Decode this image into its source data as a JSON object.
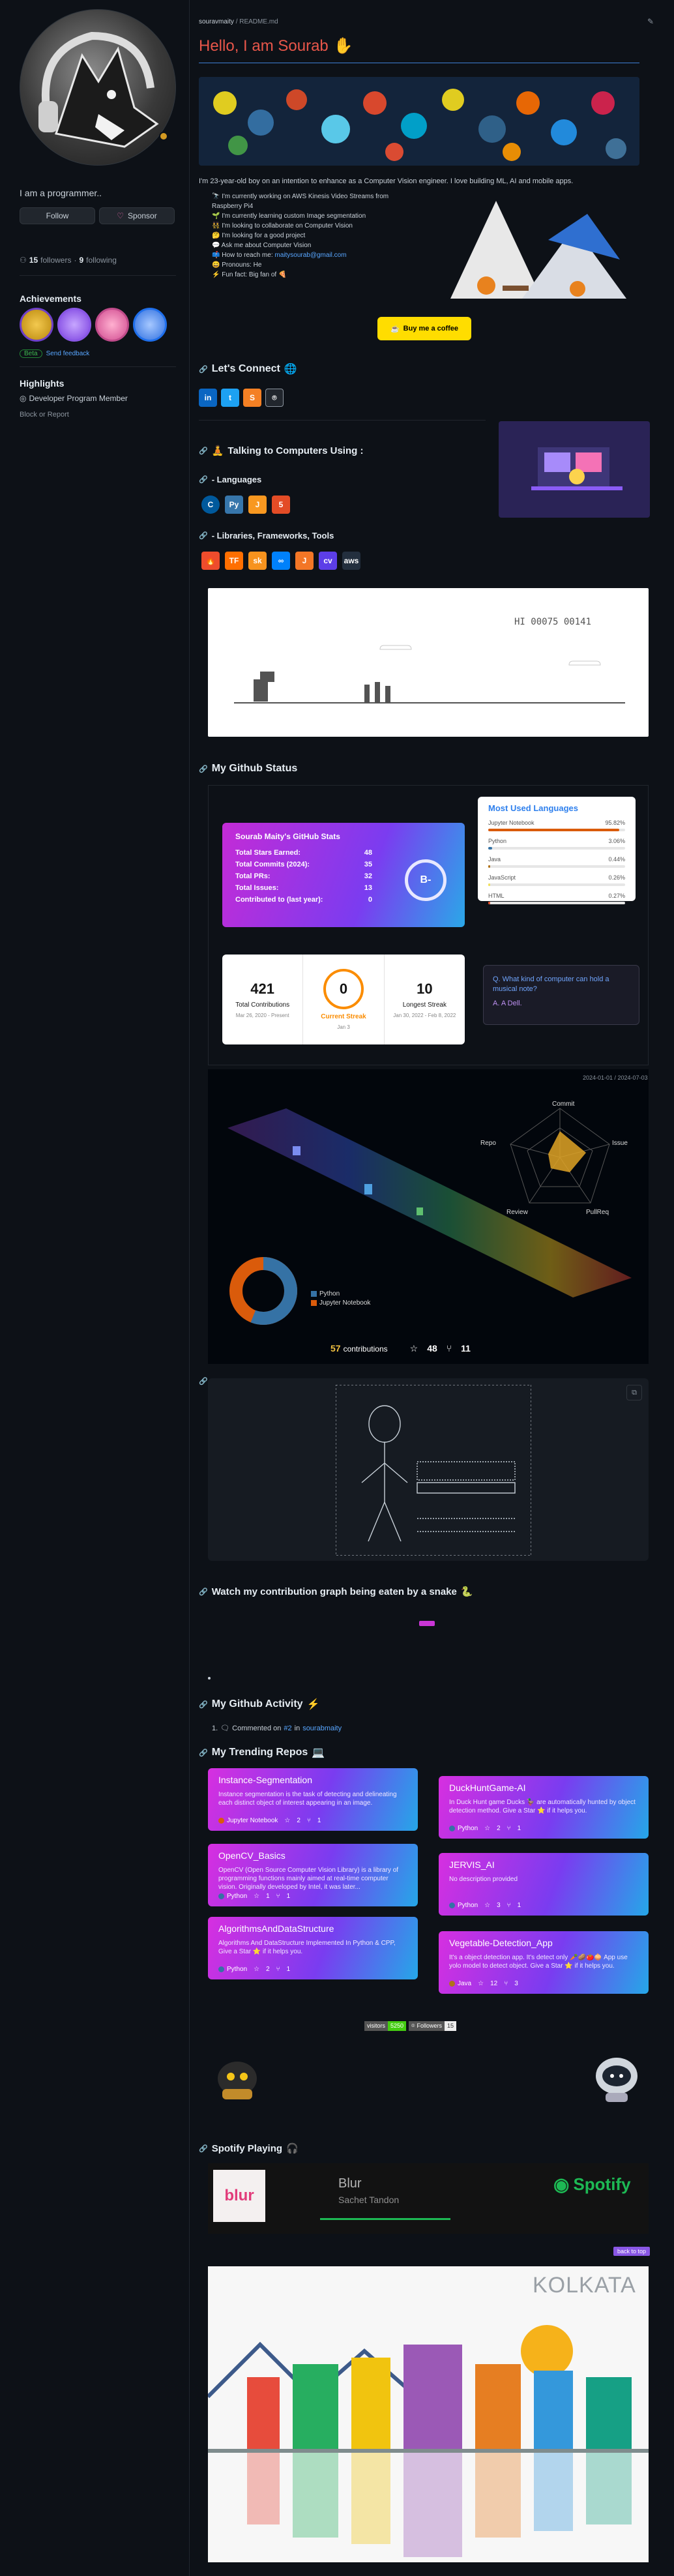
{
  "sidebar": {
    "bio": "I am a programmer..",
    "follow_label": "Follow",
    "sponsor_label": "Sponsor",
    "followers_count": "15",
    "followers_label": "followers",
    "following_count": "9",
    "following_label": "following",
    "achievements_title": "Achievements",
    "beta_label": "Beta",
    "feedback_label": "Send feedback",
    "highlights_title": "Highlights",
    "highlight_item": "Developer Program Member",
    "report_label": "Block or Report"
  },
  "readme": {
    "breadcrumb_user": "souravmaity",
    "breadcrumb_sep": "/",
    "breadcrumb_file": "README",
    "breadcrumb_ext": ".md",
    "greeting": "Hello, I am Sourab",
    "intro": "I'm 23-year-old boy on an intention to enhance as a Computer Vision engineer. I love building ML, AI and mobile apps.",
    "bullets": [
      "🔭 I'm currently working on AWS Kinesis Video Streams from Raspberry Pi4",
      "🌱 I'm currently learning custom Image segmentation",
      "👯 I'm looking to collaborate on Computer Vision",
      "🤔 I'm looking for a good project",
      "💬 Ask me about Computer Vision",
      "📫 How to reach me:",
      "😄 Pronouns: He",
      "⚡ Fun fact: Big fan of"
    ],
    "email": "maitysourab@gmail.com",
    "coffee_label": "Buy me a coffee",
    "connect_title": "Let's Connect",
    "talking_title": "Talking to Computers Using :",
    "languages_title": "- Languages",
    "libraries_title": "- Libraries, Frameworks, Tools",
    "github_status_title": "My Github Status",
    "snake_title": "Watch my contribution graph being eaten by a snake",
    "activity_title": "My Github Activity",
    "activity_item_num": "1.",
    "activity_item": "Commented on",
    "activity_item_ref": "#2",
    "activity_item_in": "in",
    "activity_item_repo": "sourabmaity",
    "trending_title": "My Trending Repos",
    "spotify_title": "Spotify Playing",
    "back_to_top": "back to top"
  },
  "dino": {
    "hi_label": "HI 00075 00141"
  },
  "stats_card": {
    "title": "Sourab Maity's GitHub Stats",
    "rows": [
      {
        "label": "Total Stars Earned:",
        "value": "48"
      },
      {
        "label": "Total Commits (2024):",
        "value": "35"
      },
      {
        "label": "Total PRs:",
        "value": "32"
      },
      {
        "label": "Total Issues:",
        "value": "13"
      },
      {
        "label": "Contributed to (last year):",
        "value": "0"
      }
    ],
    "grade": "B-"
  },
  "languages_card": {
    "title": "Most Used Languages",
    "langs": [
      {
        "name": "Jupyter Notebook",
        "pct": "95.82%",
        "value": 95.82,
        "color": "#da5b0b"
      },
      {
        "name": "Python",
        "pct": "3.06%",
        "value": 3.06,
        "color": "#3572a5"
      },
      {
        "name": "Java",
        "pct": "0.44%",
        "value": 0.44,
        "color": "#b07219"
      },
      {
        "name": "JavaScript",
        "pct": "0.26%",
        "value": 0.26,
        "color": "#f1e05a"
      },
      {
        "name": "HTML",
        "pct": "0.27%",
        "value": 0.27,
        "color": "#e34c26"
      }
    ]
  },
  "streak_card": {
    "total_value": "421",
    "total_label": "Total Contributions",
    "total_range": "Mar 26, 2020 - Present",
    "current_value": "0",
    "current_label": "Current Streak",
    "current_range": "Jan 3",
    "longest_value": "10",
    "longest_label": "Longest Streak",
    "longest_range": "Jan 30, 2022 - Feb 8, 2022"
  },
  "joke_card": {
    "q": "Q. What kind of computer can hold a musical note?",
    "a": "A. A Dell."
  },
  "metrics_3d": {
    "date_range": "2024-01-01 / 2024-07-03",
    "radar_labels": [
      "Commit",
      "Issue",
      "PullReq",
      "Review",
      "Repo"
    ],
    "legend": [
      {
        "name": "Python",
        "color": "#3572a5"
      },
      {
        "name": "Jupyter Notebook",
        "color": "#da5b0b"
      }
    ],
    "contributions_value": "57",
    "contributions_label": "contributions",
    "stars_value": "48",
    "forks_value": "11"
  },
  "repos": [
    {
      "name": "Instance-Segmentation",
      "desc": "Instance segmentation is the task of detecting and delineating each distinct object of interest appearing in an image.",
      "lang": "Jupyter Notebook",
      "lang_color": "#da5b0b",
      "stars": "2",
      "forks": "1"
    },
    {
      "name": "DuckHuntGame-AI",
      "desc": "In Duck Hunt game Ducks 🦆 are automatically hunted by object detection method. Give a Star ⭐ if it helps you.",
      "lang": "Python",
      "lang_color": "#3572a5",
      "stars": "2",
      "forks": "1"
    },
    {
      "name": "OpenCV_Basics",
      "desc": "OpenCV (Open Source Computer Vision Library) is a library of programming functions mainly aimed at real-time computer vision. Originally developed by Intel, it was later...",
      "lang": "Python",
      "lang_color": "#3572a5",
      "stars": "1",
      "forks": "1"
    },
    {
      "name": "JERVIS_AI",
      "desc": "No description provided",
      "lang": "Python",
      "lang_color": "#3572a5",
      "stars": "3",
      "forks": "1"
    },
    {
      "name": "AlgorithmsAndDataStructure",
      "desc": "Algorithms And DataStructure Implemented In Python & CPP, Give a Star ⭐ if it helps you.",
      "lang": "Python",
      "lang_color": "#3572a5",
      "stars": "2",
      "forks": "1"
    },
    {
      "name": "Vegetable-Detection_App",
      "desc": "It's a object detection app. It's detect only 🥕🥔🍅🧅 App use yolo model to detect object. Give a Star ⭐ if it helps you.",
      "lang": "Java",
      "lang_color": "#b07219",
      "stars": "12",
      "forks": "3"
    }
  ],
  "badges": {
    "visitors_label": "visitors",
    "visitors_value": "5250",
    "followers_label": "Followers",
    "followers_value": "15"
  },
  "spotify": {
    "song": "Blur",
    "artist": "Sachet Tandon",
    "brand": "Spotify",
    "album_text": "blur"
  },
  "kolkata": {
    "city": "KOLKATA"
  }
}
